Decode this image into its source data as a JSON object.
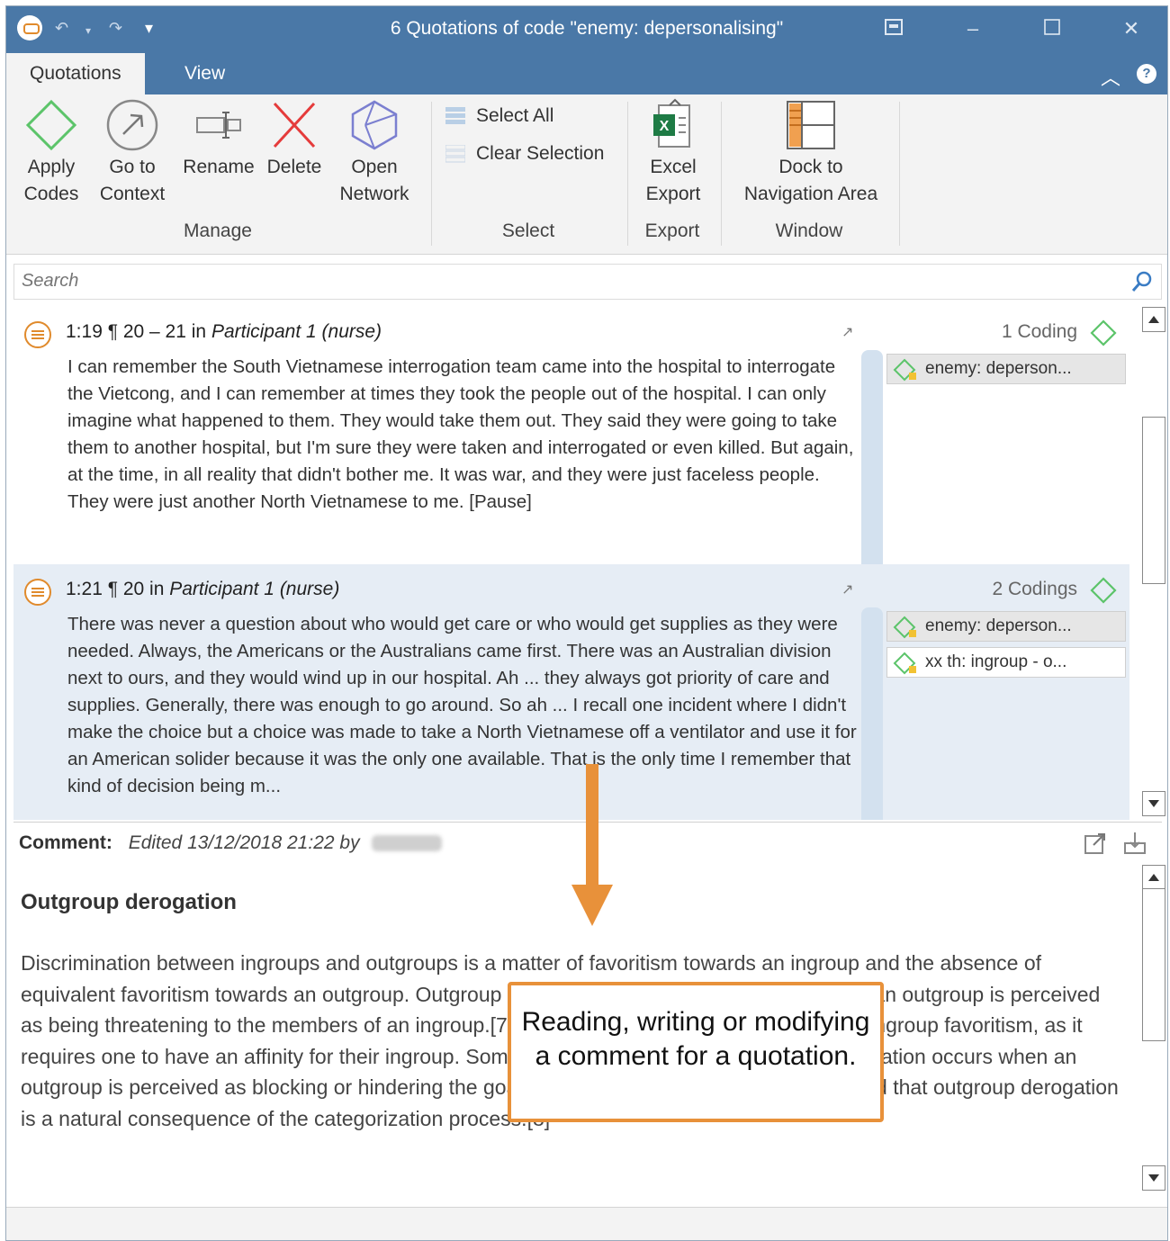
{
  "window": {
    "title": "6 Quotations of code \"enemy: depersonalising\""
  },
  "ribbon": {
    "tabs": [
      {
        "label": "Quotations"
      },
      {
        "label": "View"
      }
    ],
    "buttons": {
      "apply_codes": "Apply Codes",
      "go_to_context": "Go to Context",
      "rename": "Rename",
      "delete": "Delete",
      "open_network": "Open Network",
      "select_all": "Select All",
      "clear_selection": "Clear Selection",
      "excel_export": "Excel Export",
      "dock": "Dock to Navigation Area"
    },
    "groups": {
      "manage": "Manage",
      "select": "Select",
      "export": "Export",
      "window": "Window"
    }
  },
  "search": {
    "placeholder": "Search"
  },
  "quotations": [
    {
      "id": "1:19",
      "para": "¶ 20 – 21",
      "in_label": "in",
      "source": "Participant 1 (nurse)",
      "text": "I can remember the South Vietnamese interrogation team came into the hospital to interrogate the Vietcong, and I can remember at times they took the people out of the hospital. I can only imagine what happened to them. They would take them out. They said they were going to take them to another hospital, but I'm sure they were taken and interrogated or even killed. But again, at the time, in all reality that didn't bother me. It was war, and they were just faceless people. They were just another North Vietnamese to me. [Pause]",
      "coding_count": "1 Coding",
      "codes": [
        "enemy: deperson..."
      ]
    },
    {
      "id": "1:21",
      "para": "¶ 20",
      "in_label": "in",
      "source": "Participant 1 (nurse)",
      "text": "There was never a question about who would get care or who would get supplies as they were needed. Always, the Americans or the Australians came first. There was an Australian division next to ours, and they would wind up in our hospital. Ah ... they always got priority of care and supplies. Generally, there was enough to go around. So ah ... I recall one incident where I didn't make the choice but a choice was made to take a North Vietnamese off a ventilator and use it for an American solider because it was the only one available. That is the only time I remember that kind of decision being m...",
      "coding_count": "2 Codings",
      "codes": [
        "enemy: deperson...",
        "xx th: ingroup - o..."
      ]
    }
  ],
  "comment": {
    "label": "Comment:",
    "edited": "Edited 13/12/2018 21:22 by",
    "title": "Outgroup derogation",
    "body": "Discrimination between ingroups and outgroups is a matter of favoritism towards an ingroup and the absence of equivalent favoritism towards an outgroup. Outgroup derogation is the phenomenon in which an outgroup is perceived as being threatening to the members of an ingroup.[7] This phenomenon often accompanies ingroup favoritism, as it requires one to have an affinity for their ingroup. Some research suggests that outgroup derogation occurs when an outgroup is perceived as blocking or hindering the goals of an ingroup. It has also been argued that outgroup derogation is a natural consequence of the categorization process.[8]"
  },
  "callout": {
    "text": "Reading, writing or modifying a comment for a quotation."
  },
  "colors": {
    "title_bar": "#4a78a7",
    "accent_orange": "#e8913a",
    "code_green": "#5cc46a",
    "selected_row": "#e6edf5"
  }
}
